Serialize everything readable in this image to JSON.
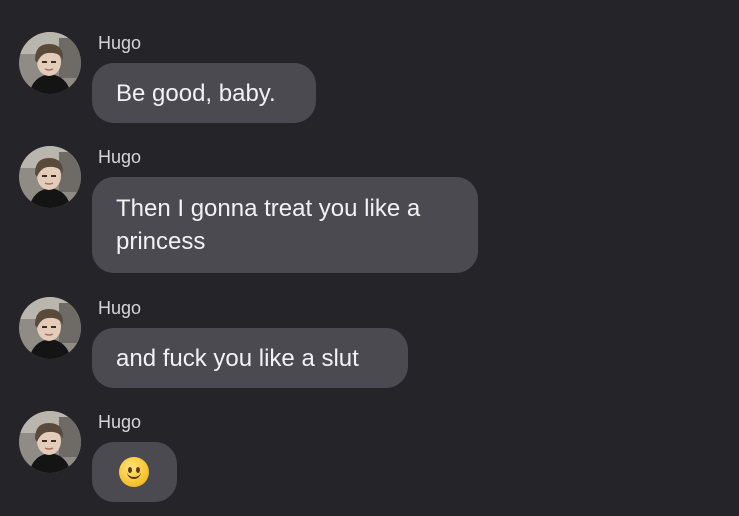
{
  "messages": [
    {
      "sender": "Hugo",
      "text": "Be good, baby."
    },
    {
      "sender": "Hugo",
      "line1": "Then I gonna treat you like a",
      "line2": "princess"
    },
    {
      "sender": "Hugo",
      "text": "and fuck you like a slut"
    },
    {
      "sender": "Hugo",
      "emoji": "slightly-smiling-face-icon"
    }
  ],
  "colors": {
    "background": "#242429",
    "bubble": "#4a4a50",
    "sender_text": "#d6d6da",
    "message_text": "#f2f2f5"
  }
}
